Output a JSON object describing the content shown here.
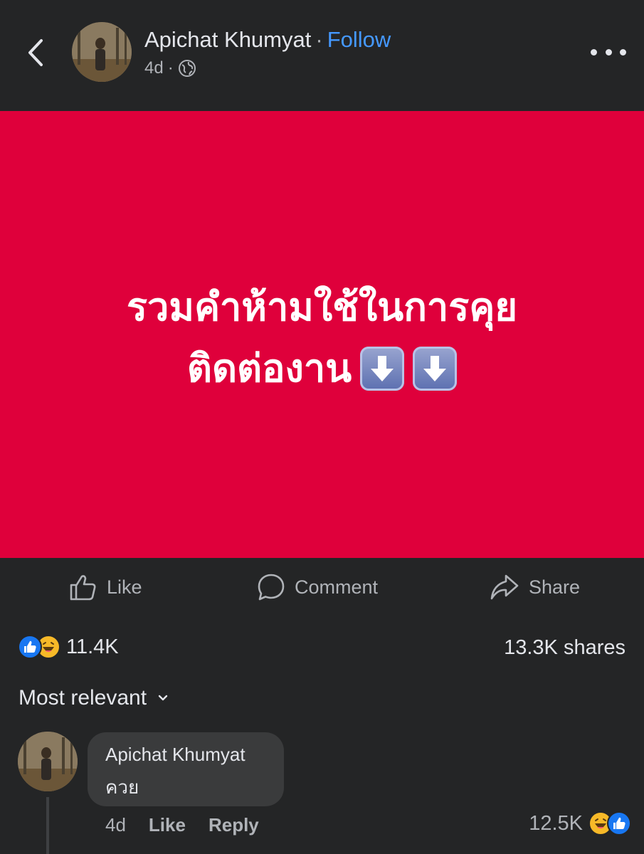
{
  "header": {
    "author_name": "Apichat Khumyat",
    "separator": "·",
    "follow_label": "Follow",
    "time": "4d",
    "time_separator": "·",
    "audience_icon": "globe-icon"
  },
  "post": {
    "text_line1": "รวมคำห้ามใช้ในการคุย",
    "text_line2": "ติดต่องาน",
    "emoji": [
      "down-arrow-emoji",
      "down-arrow-emoji"
    ],
    "background_color": "#df003b"
  },
  "actions": {
    "like_label": "Like",
    "comment_label": "Comment",
    "share_label": "Share"
  },
  "stats": {
    "reaction_count": "11.4K",
    "reaction_icons": [
      "like-reaction-icon",
      "haha-reaction-icon"
    ],
    "shares": "13.3K shares"
  },
  "comments": {
    "sort_label": "Most relevant",
    "items": [
      {
        "author": "Apichat Khumyat",
        "text": "ควย",
        "time": "4d",
        "like_label": "Like",
        "reply_label": "Reply",
        "reaction_count": "12.5K"
      }
    ]
  },
  "colors": {
    "accent": "#4599ff",
    "background": "#242526",
    "bubble": "#3a3b3c",
    "like_blue": "#1877f2",
    "haha_yellow": "#f7b928"
  }
}
